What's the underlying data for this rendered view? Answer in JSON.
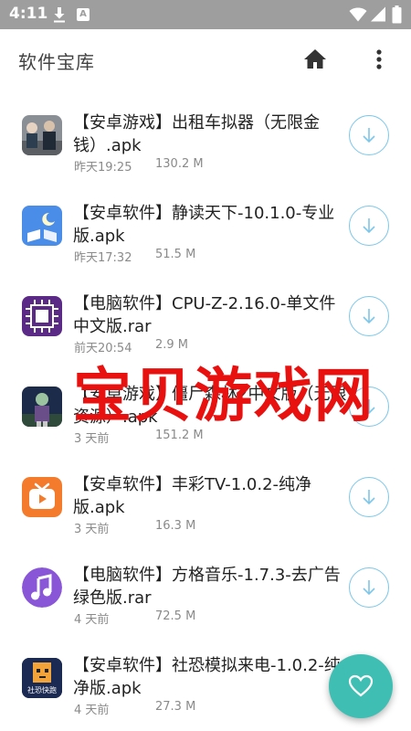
{
  "status_bar": {
    "time": "4:11",
    "notification_letter": "A"
  },
  "app_bar": {
    "title": "软件宝库",
    "home_icon": "home-icon",
    "more_icon": "more-vert-icon"
  },
  "items": [
    {
      "title": "【安卓游戏】出租车拟器（无限金钱）.apk",
      "date": "昨天19:25",
      "size": "130.2 M",
      "icon": "taxi-game-icon"
    },
    {
      "title": "【安卓软件】静读天下-10.1.0-专业版.apk",
      "date": "昨天17:32",
      "size": "51.5 M",
      "icon": "book-reader-icon"
    },
    {
      "title": "【电脑软件】CPU-Z-2.16.0-单文件中文版.rar",
      "date": "前天20:54",
      "size": "2.9 M",
      "icon": "cpu-icon"
    },
    {
      "title": "【安卓游戏】僵尸森林2中文版（无限资源）.apk",
      "date": "3 天前",
      "size": "151.2 M",
      "icon": "zombie-game-icon"
    },
    {
      "title": "【安卓软件】丰彩TV-1.0.2-纯净版.apk",
      "date": "3 天前",
      "size": "16.3 M",
      "icon": "tv-icon"
    },
    {
      "title": "【电脑软件】方格音乐-1.7.3-去广告绿色版.rar",
      "date": "4 天前",
      "size": "72.5 M",
      "icon": "music-note-icon"
    },
    {
      "title": "【安卓软件】社恐模拟来电-1.0.2-纯净版.apk",
      "date": "4 天前",
      "size": "27.3 M",
      "icon": "fake-call-icon",
      "icon_caption": "社恐快跑"
    }
  ],
  "watermark": "宝贝游戏网",
  "fab_icon": "heart-icon",
  "colors": {
    "status_bar": "#9e9e9e",
    "accent_teal": "#3fbfb3",
    "download_ring": "#7cc7ea",
    "watermark": "#e8110f"
  }
}
